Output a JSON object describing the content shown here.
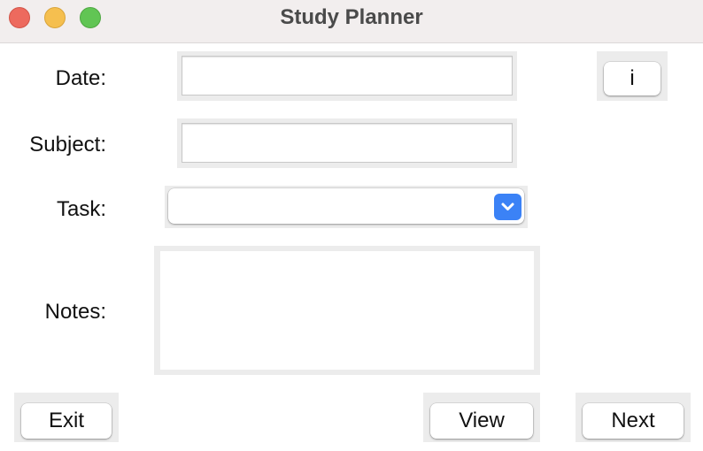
{
  "window": {
    "title": "Study Planner"
  },
  "form": {
    "date_label": "Date:",
    "date_value": "",
    "subject_label": "Subject:",
    "subject_value": "",
    "task_label": "Task:",
    "task_selected": "",
    "notes_label": "Notes:",
    "notes_value": ""
  },
  "buttons": {
    "info_label": "i",
    "exit_label": "Exit",
    "view_label": "View",
    "next_label": "Next"
  },
  "colors": {
    "accent": "#3b82f6",
    "close": "#ed6a5e",
    "minimize": "#f5bf4f",
    "zoom": "#61c554"
  },
  "icons": {
    "task_dropdown": "chevron-down-icon"
  }
}
